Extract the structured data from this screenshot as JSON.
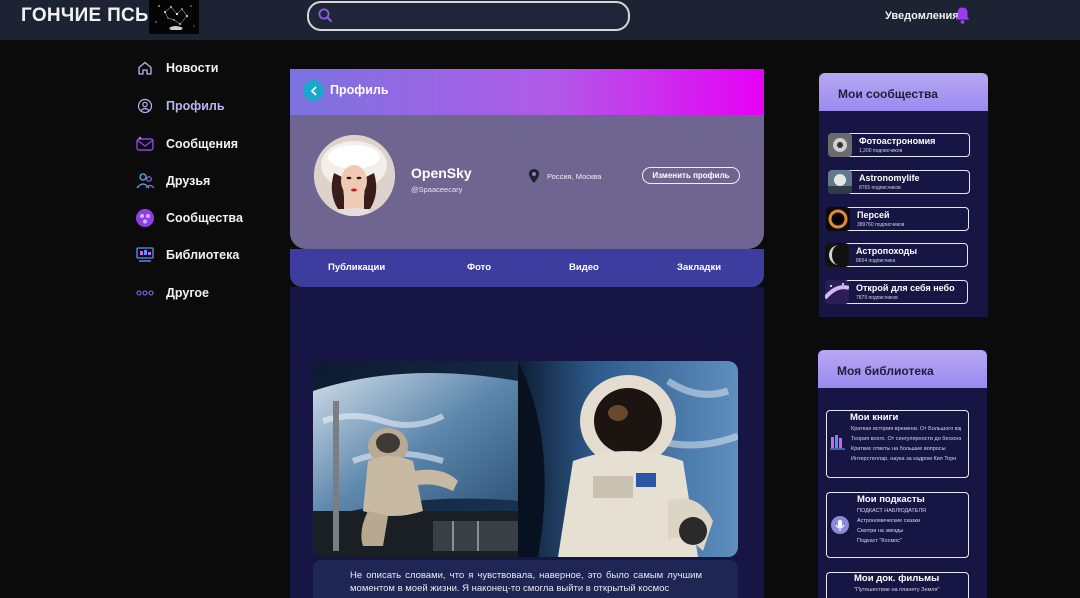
{
  "header": {
    "brand": "ГОНЧИЕ ПСЫ",
    "search_placeholder": "",
    "notifications_label": "Уведомления"
  },
  "sidebar": {
    "items": [
      {
        "label": "Новости",
        "icon": "home-icon"
      },
      {
        "label": "Профиль",
        "icon": "user-icon",
        "active": true
      },
      {
        "label": "Сообщения",
        "icon": "messages-icon"
      },
      {
        "label": "Друзья",
        "icon": "friends-icon"
      },
      {
        "label": "Сообщества",
        "icon": "communities-icon"
      },
      {
        "label": "Библиотека",
        "icon": "library-icon"
      },
      {
        "label": "Другое",
        "icon": "more-icon"
      }
    ]
  },
  "profile": {
    "header_title": "Профиль",
    "name": "OpenSky",
    "handle": "@Spaaceecary",
    "location": "Россия, Москва",
    "edit_label": "Изменить профиль",
    "tabs": [
      "Публикации",
      "Фото",
      "Видео",
      "Закладки"
    ]
  },
  "post": {
    "text": "Не описать словами, что я чувствовала, наверное, это было самым лучшим моментом в моей жизни. Я наконец-то смогла выйти в открытый космос"
  },
  "communities": {
    "title": "Мои сообщества",
    "items": [
      {
        "name": "Фотоастрономия",
        "subs": "1,200 подписчиков"
      },
      {
        "name": "Astronomylife",
        "subs": "8765 подписчиков"
      },
      {
        "name": "Персей",
        "subs": "389760 подписчиков"
      },
      {
        "name": "Астропоходы",
        "subs": "8654 подписчика"
      },
      {
        "name": "Открой для себя небо",
        "subs": "7879 подписчиков"
      }
    ]
  },
  "library": {
    "title": "Моя библиотека",
    "books": {
      "title": "Мои книги",
      "lines": [
        "Краткая история времени. От Большого взрыва",
        "Теория всего. От сингулярности до бесконечности",
        "Краткие ответы на большие вопросы",
        "Интерстеллар. наука за кадром Кип Торн"
      ]
    },
    "podcasts": {
      "title": "Мои подкасты",
      "lines": [
        "ПОДКАСТ НАБЛЮДАТЕЛЯ",
        "Астрономические сказки",
        "Смотри на звезды",
        "Подкаст \"Космос\""
      ]
    },
    "films": {
      "title": "Мои док. фильмы",
      "lines": [
        "\"Путешествие на планету Земля\""
      ]
    }
  },
  "colors": {
    "header_bg": "#1d2333",
    "page_bg": "#0b0b0b",
    "accent_gradient_start": "#7b73de",
    "accent_gradient_end": "#e700f5",
    "profile_card": "#6e6690",
    "tabs_bg": "#3c3d9e",
    "panel_bg": "#161544"
  }
}
